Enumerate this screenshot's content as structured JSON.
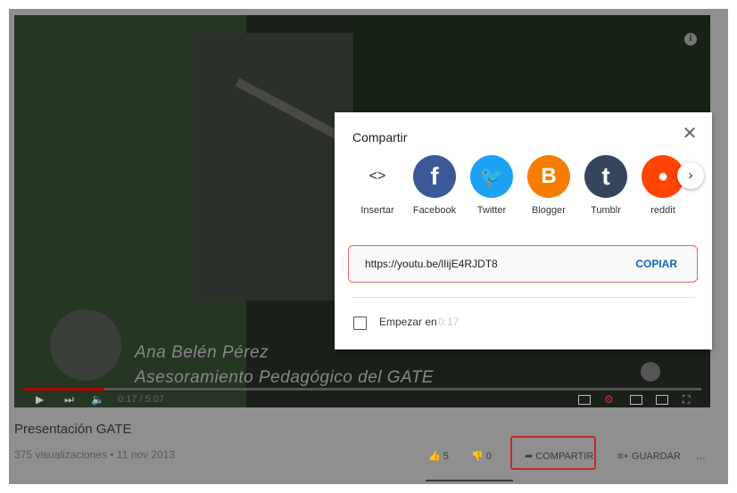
{
  "video": {
    "caption_line1": "Ana Belén Pérez",
    "caption_line2": "Asesoramiento Pedagógico del GATE",
    "time": "0:17 / 5:07"
  },
  "page": {
    "title": "Presentación GATE",
    "meta": "375 visualizaciones • 11 nov 2013",
    "likes": "5",
    "dislikes": "0",
    "share_label": "COMPARTIR",
    "save_label": "GUARDAR",
    "more_label": "…"
  },
  "dialog": {
    "title": "Compartir",
    "close_label": "✕",
    "share_targets": [
      {
        "label": "Insertar",
        "icon": "embed-icon",
        "glyph": "<>",
        "color": "#f2f2f2"
      },
      {
        "label": "Facebook",
        "icon": "facebook-icon",
        "glyph": "f",
        "color": "#3b5998"
      },
      {
        "label": "Twitter",
        "icon": "twitter-icon",
        "glyph": "🐦",
        "color": "#1da1f2"
      },
      {
        "label": "Blogger",
        "icon": "blogger-icon",
        "glyph": "B",
        "color": "#f57d00"
      },
      {
        "label": "Tumblr",
        "icon": "tumblr-icon",
        "glyph": "t",
        "color": "#35465c"
      },
      {
        "label": "reddit",
        "icon": "reddit-icon",
        "glyph": "●",
        "color": "#ff4500"
      }
    ],
    "next_label": "›",
    "url": "https://youtu.be/lIijE4RJDT8",
    "copy_label": "COPIAR",
    "start_at_label": "Empezar en",
    "start_at_time": "0:17"
  }
}
